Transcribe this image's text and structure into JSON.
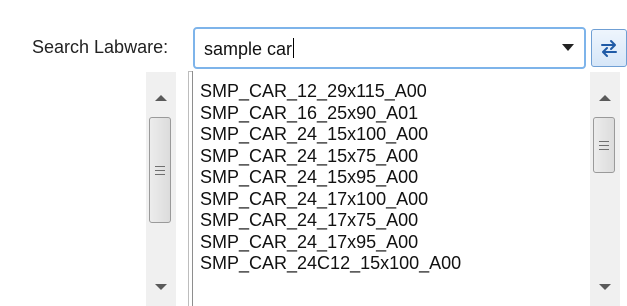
{
  "search": {
    "label": "Search Labware:",
    "value": "sample car",
    "dropdown_icon": "chevron-down-icon",
    "swap_icon": "swap-arrows-icon"
  },
  "labware_list": {
    "items": [
      "SMP_CAR_12_29x115_A00",
      "SMP_CAR_16_25x90_A01",
      "SMP_CAR_24_15x100_A00",
      "SMP_CAR_24_15x75_A00",
      "SMP_CAR_24_15x95_A00",
      "SMP_CAR_24_17x100_A00",
      "SMP_CAR_24_17x75_A00",
      "SMP_CAR_24_17x95_A00",
      "SMP_CAR_24C12_15x100_A00"
    ]
  },
  "colors": {
    "combo_focus_border": "#7eb4ea",
    "swap_button_border": "#6f9fd4",
    "scrollbar_track": "#f0f0f0"
  }
}
